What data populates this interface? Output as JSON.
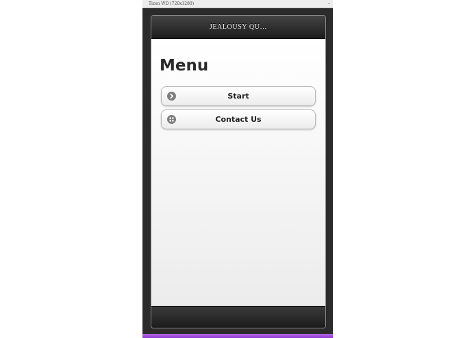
{
  "window": {
    "title": "Tizen WD (720x1280)",
    "minimize_glyph": "–"
  },
  "app": {
    "header_title": "JEALOUSY QU…",
    "page_title": "Menu",
    "buttons": [
      {
        "label": "Start",
        "icon": "arrow-right-circle-icon"
      },
      {
        "label": "Contact Us",
        "icon": "grid-icon"
      }
    ]
  },
  "colors": {
    "header_bg": "#2a2a2a",
    "content_bg": "#f4f4f4",
    "button_border": "#b9b9b9",
    "icon_gray": "#7d7d7d",
    "accent_bar": "#9a46d8"
  }
}
